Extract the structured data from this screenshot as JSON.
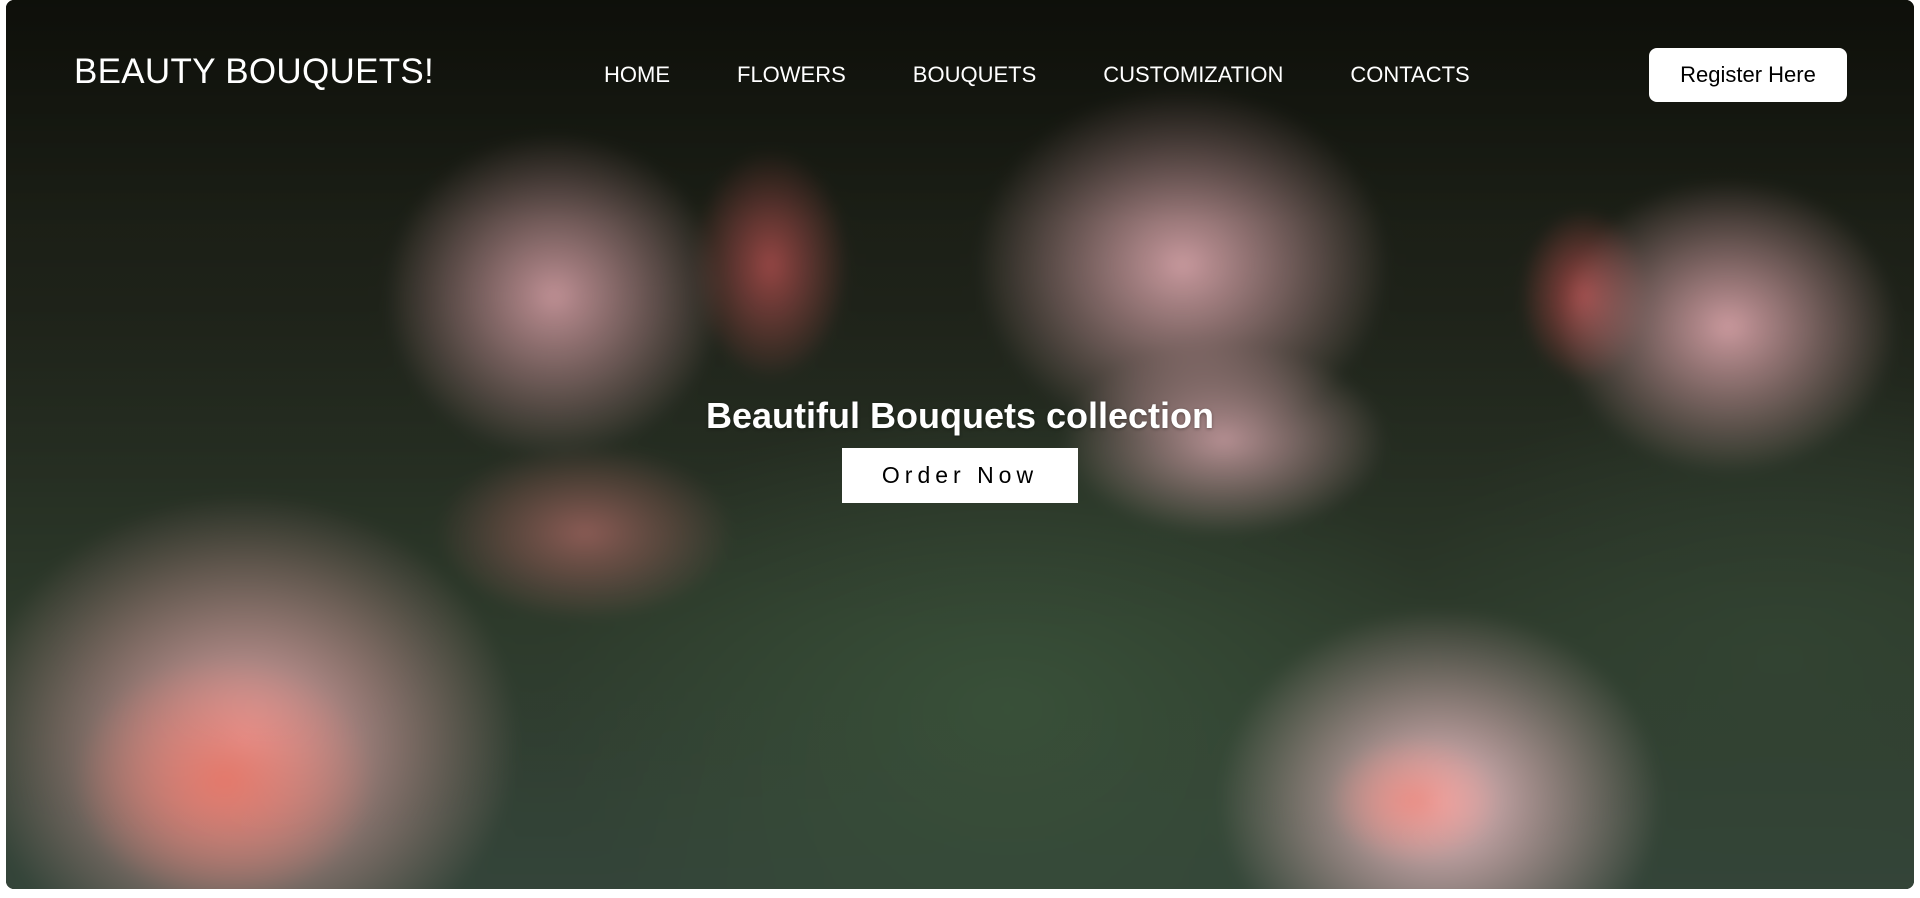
{
  "navbar": {
    "brand": "BEAUTY BOUQUETS!",
    "links": [
      {
        "label": "HOME"
      },
      {
        "label": "FLOWERS"
      },
      {
        "label": "BOUQUETS"
      },
      {
        "label": "CUSTOMIZATION"
      },
      {
        "label": "CONTACTS"
      }
    ],
    "register_label": "Register Here"
  },
  "hero": {
    "title": "Beautiful Bouquets collection",
    "cta_label": "Order Now"
  },
  "colors": {
    "text_light": "#ffffff",
    "button_bg": "#ffffff",
    "button_text": "#000000",
    "background_dark": "#1c1f17",
    "accent_pink": "#e8aaac"
  }
}
